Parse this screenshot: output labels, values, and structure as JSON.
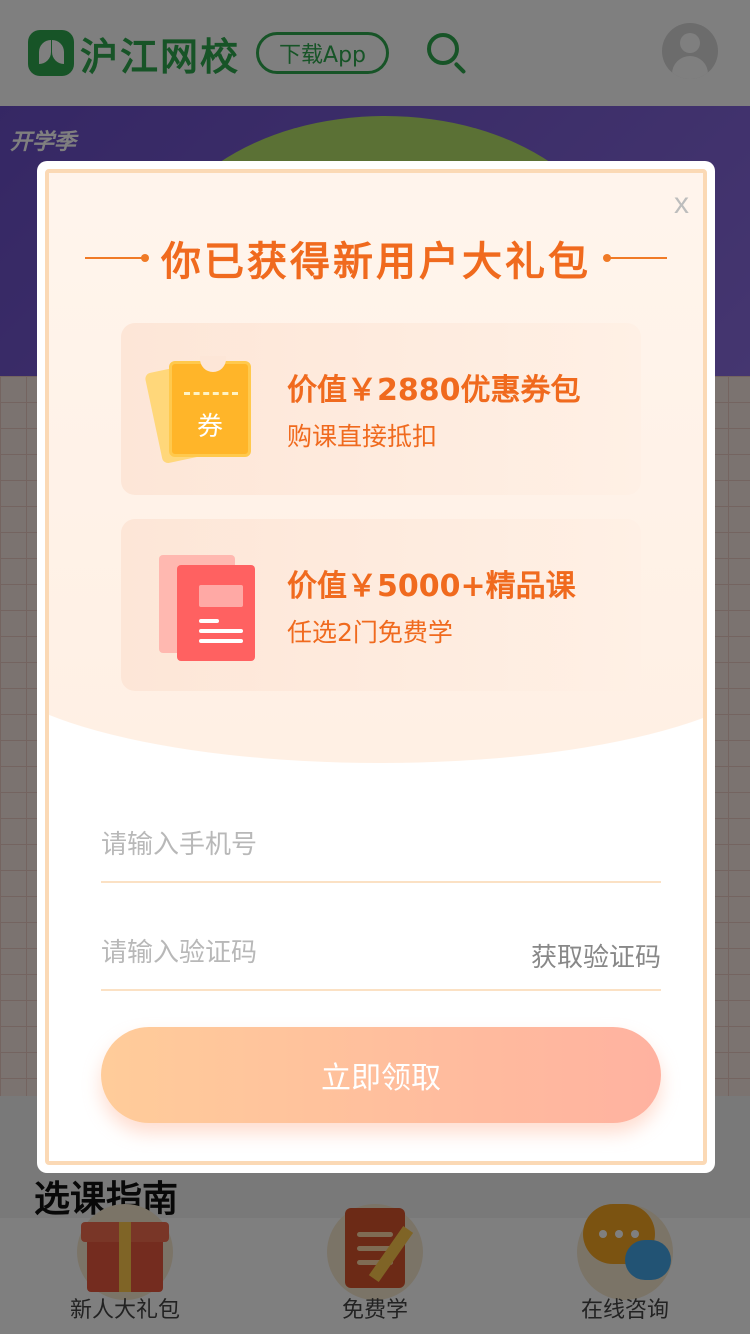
{
  "header": {
    "logo_text": "沪江网校",
    "download_label": "下载App"
  },
  "banner": {
    "tag": "开学季"
  },
  "guide": {
    "title": "选课指南"
  },
  "bottom_nav": {
    "items": [
      {
        "label": "新人大礼包",
        "icon": "gift-icon"
      },
      {
        "label": "免费学",
        "icon": "book-icon"
      },
      {
        "label": "在线咨询",
        "icon": "chat-icon"
      }
    ]
  },
  "modal": {
    "close_label": "x",
    "title": "你已获得新用户大礼包",
    "benefits": [
      {
        "main": "价值￥2880优惠券包",
        "sub": "购课直接抵扣",
        "icon": "coupon-icon",
        "icon_text": "券"
      },
      {
        "main": "价值￥5000+精品课",
        "sub": "任选2门免费学",
        "icon": "course-book-icon"
      }
    ],
    "phone_placeholder": "请输入手机号",
    "code_placeholder": "请输入验证码",
    "get_code_label": "获取验证码",
    "submit_label": "立即领取"
  },
  "colors": {
    "brand_green": "#2fa84f",
    "accent_orange": "#f06a1e",
    "button_gradient_start": "#ffcc9a",
    "button_gradient_end": "#ffb2a0"
  }
}
